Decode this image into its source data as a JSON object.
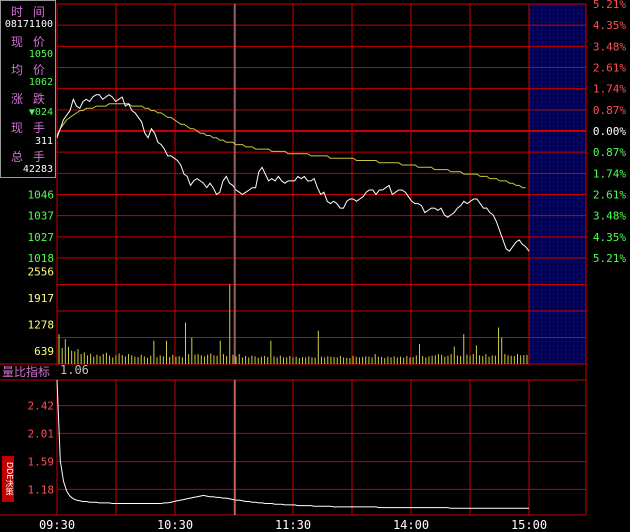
{
  "colors": {
    "background": "#000000",
    "grid": "#c80000",
    "price_line": "#ffffff",
    "avg_line": "#c8c840",
    "volume_bar": "#d0d040",
    "up_text": "#ff5050",
    "down_text": "#50ff50",
    "label_text": "#ff50ff",
    "cursor": "#60c0c0",
    "future_zone": "#000060"
  },
  "info_panel": {
    "time_label": "时 间",
    "time_value": "08171100",
    "price_label": "现 价",
    "price_value": "1050",
    "avg_label": "均 价",
    "avg_value": "1062",
    "change_label": "涨 跌",
    "change_value": "▼024",
    "hand_label": "现 手",
    "hand_value": "311",
    "total_label": "总 手",
    "total_value": "42283"
  },
  "ratio_panel": {
    "label": "量比指标",
    "value": "1.06"
  },
  "dde_badge": {
    "text": "DDE决策"
  },
  "chart_data": [
    {
      "type": "line",
      "name": "price",
      "x_categories": [
        "09:30",
        "10:30",
        "11:30",
        "14:00",
        "15:00"
      ],
      "left_ticks": [
        "1046",
        "1037",
        "1027",
        "1018"
      ],
      "right_ticks_up": [
        "5.21%",
        "4.35%",
        "3.48%",
        "2.61%",
        "1.74%",
        "0.87%"
      ],
      "right_tick_zero": "0.00%",
      "right_ticks_down": [
        "0.87%",
        "1.74%",
        "2.61%",
        "3.48%",
        "4.35%",
        "5.21%"
      ],
      "ylim": [
        1018,
        1130
      ],
      "baseline": 1074,
      "price": [
        1071,
        1075,
        1079,
        1081,
        1083,
        1088,
        1085,
        1084,
        1087,
        1088,
        1087,
        1089,
        1090,
        1090,
        1088,
        1089,
        1090,
        1089,
        1087,
        1088,
        1089,
        1085,
        1086,
        1083,
        1082,
        1080,
        1078,
        1073,
        1071,
        1075,
        1073,
        1069,
        1068,
        1066,
        1063,
        1063,
        1062,
        1061,
        1059,
        1055,
        1054,
        1050,
        1052,
        1053,
        1052,
        1051,
        1049,
        1051,
        1049,
        1046,
        1047,
        1052,
        1054,
        1051,
        1050,
        1048,
        1047,
        1046,
        1047,
        1048,
        1049,
        1049,
        1056,
        1058,
        1055,
        1052,
        1053,
        1052,
        1054,
        1052,
        1051,
        1052,
        1052,
        1052,
        1054,
        1053,
        1054,
        1052,
        1052,
        1053,
        1049,
        1046,
        1047,
        1043,
        1042,
        1043,
        1042,
        1040,
        1040,
        1043,
        1044,
        1044,
        1043,
        1044,
        1045,
        1047,
        1048,
        1048,
        1046,
        1048,
        1048,
        1049,
        1050,
        1046,
        1047,
        1048,
        1048,
        1047,
        1045,
        1043,
        1042,
        1042,
        1041,
        1038,
        1039,
        1040,
        1040,
        1039,
        1040,
        1037,
        1036,
        1037,
        1038,
        1040,
        1041,
        1043,
        1042,
        1043,
        1044,
        1044,
        1042,
        1040,
        1040,
        1038,
        1037,
        1034,
        1030,
        1026,
        1022,
        1021,
        1023,
        1025,
        1026,
        1024,
        1023,
        1021
      ],
      "avg": [
        1072,
        1075,
        1077,
        1079,
        1080,
        1081,
        1082,
        1083,
        1083,
        1084,
        1084,
        1084,
        1085,
        1085,
        1085,
        1085,
        1086,
        1086,
        1086,
        1086,
        1086,
        1086,
        1086,
        1085,
        1085,
        1085,
        1085,
        1084,
        1084,
        1083,
        1083,
        1082,
        1082,
        1081,
        1080,
        1080,
        1079,
        1078,
        1077,
        1077,
        1076,
        1075,
        1075,
        1074,
        1073,
        1073,
        1072,
        1072,
        1071,
        1071,
        1070,
        1070,
        1069,
        1069,
        1069,
        1068,
        1068,
        1068,
        1067,
        1067,
        1067,
        1066,
        1066,
        1066,
        1066,
        1066,
        1065,
        1065,
        1065,
        1065,
        1065,
        1064,
        1064,
        1064,
        1064,
        1064,
        1064,
        1064,
        1063,
        1063,
        1063,
        1063,
        1063,
        1063,
        1062,
        1062,
        1062,
        1062,
        1062,
        1062,
        1062,
        1062,
        1061,
        1061,
        1061,
        1061,
        1061,
        1061,
        1061,
        1060,
        1060,
        1060,
        1060,
        1060,
        1060,
        1060,
        1059,
        1059,
        1059,
        1059,
        1059,
        1058,
        1058,
        1058,
        1058,
        1058,
        1057,
        1057,
        1057,
        1057,
        1057,
        1056,
        1056,
        1056,
        1056,
        1055,
        1055,
        1055,
        1055,
        1055,
        1054,
        1054,
        1054,
        1053,
        1053,
        1053,
        1052,
        1052,
        1052,
        1051,
        1051,
        1050,
        1050,
        1049,
        1049
      ]
    },
    {
      "type": "bar",
      "name": "volume",
      "left_ticks": [
        "2556",
        "1917",
        "1278",
        "639"
      ],
      "ylim": [
        0,
        3195
      ],
      "values": [
        900,
        480,
        750,
        520,
        400,
        380,
        450,
        300,
        350,
        260,
        310,
        220,
        280,
        240,
        300,
        340,
        250,
        200,
        260,
        320,
        270,
        230,
        300,
        260,
        220,
        210,
        280,
        230,
        190,
        250,
        700,
        200,
        260,
        230,
        700,
        210,
        280,
        220,
        240,
        200,
        1250,
        300,
        800,
        280,
        300,
        260,
        230,
        280,
        320,
        260,
        250,
        700,
        300,
        240,
        2400,
        280,
        230,
        300,
        200,
        240,
        200,
        250,
        230,
        190,
        220,
        240,
        210,
        700,
        230,
        200,
        250,
        200,
        200,
        240,
        200,
        220,
        180,
        210,
        200,
        230,
        200,
        190,
        1000,
        220,
        200,
        230,
        220,
        210,
        200,
        240,
        200,
        190,
        180,
        250,
        220,
        200,
        210,
        230,
        220,
        200,
        300,
        220,
        210,
        180,
        220,
        200,
        230,
        200,
        220,
        190,
        240,
        200,
        210,
        260,
        600,
        240,
        200,
        230,
        250,
        260,
        300,
        280,
        220,
        250,
        300,
        520,
        260,
        240,
        900,
        280,
        250,
        300,
        560,
        260,
        240,
        300,
        220,
        260,
        250,
        1100,
        800,
        300,
        260,
        250,
        240,
        300,
        260,
        270,
        280
      ]
    },
    {
      "type": "line",
      "name": "volume_ratio",
      "left_ticks": [
        "2.42",
        "2.01",
        "1.59",
        "1.18"
      ],
      "ylim": [
        0.8,
        2.8
      ],
      "values": [
        2.8,
        1.6,
        1.3,
        1.15,
        1.08,
        1.04,
        1.02,
        1.01,
        1.0,
        1.0,
        0.99,
        0.99,
        0.99,
        0.98,
        0.98,
        0.98,
        0.98,
        0.97,
        0.97,
        0.97,
        0.97,
        0.97,
        0.97,
        0.97,
        0.97,
        0.97,
        0.97,
        0.97,
        0.97,
        0.97,
        0.97,
        0.97,
        0.97,
        0.98,
        0.98,
        0.99,
        1.0,
        1.01,
        1.02,
        1.03,
        1.04,
        1.05,
        1.06,
        1.07,
        1.08,
        1.09,
        1.08,
        1.07,
        1.07,
        1.06,
        1.06,
        1.05,
        1.05,
        1.04,
        1.03,
        1.02,
        1.02,
        1.01,
        1.0,
        1.0,
        0.99,
        0.99,
        0.98,
        0.98,
        0.97,
        0.97,
        0.97,
        0.96,
        0.96,
        0.96,
        0.95,
        0.95,
        0.95,
        0.95,
        0.94,
        0.94,
        0.94,
        0.94,
        0.94,
        0.93,
        0.93,
        0.93,
        0.93,
        0.93,
        0.93,
        0.92,
        0.92,
        0.92,
        0.92,
        0.92,
        0.92,
        0.92,
        0.92,
        0.92,
        0.92,
        0.92,
        0.92,
        0.92,
        0.92,
        0.91,
        0.91,
        0.91,
        0.91,
        0.91,
        0.91,
        0.91,
        0.91,
        0.91,
        0.91,
        0.91,
        0.91,
        0.91,
        0.91,
        0.91,
        0.91,
        0.91,
        0.91,
        0.91,
        0.91,
        0.91,
        0.91,
        0.9,
        0.9,
        0.9,
        0.9,
        0.9,
        0.9,
        0.9,
        0.9,
        0.9,
        0.9,
        0.9,
        0.9,
        0.9,
        0.9,
        0.9,
        0.9,
        0.9,
        0.9,
        0.9,
        0.9,
        0.9,
        0.9,
        0.9,
        0.9,
        0.9
      ]
    }
  ]
}
